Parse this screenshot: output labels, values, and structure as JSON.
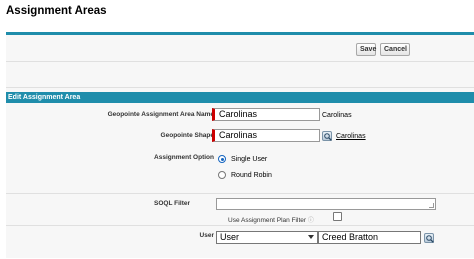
{
  "page": {
    "title": "Assignment Areas"
  },
  "toolbar": {
    "save_label": "Save",
    "cancel_label": "Cancel"
  },
  "section": {
    "title": "Edit Assignment Area"
  },
  "fields": {
    "area_name": {
      "label": "Geopointe Assignment Area Name",
      "value": "Carolinas",
      "preview": "Carolinas"
    },
    "shape": {
      "label": "Geopointe Shape",
      "value": "Carolinas",
      "link": "Carolinas"
    },
    "assignment_option": {
      "label": "Assignment Option",
      "options": [
        {
          "label": "Single User",
          "checked": true
        },
        {
          "label": "Round Robin",
          "checked": false
        }
      ]
    },
    "soql_filter": {
      "label": "SOQL Filter",
      "value": ""
    },
    "plan_filter": {
      "label": "Use Assignment Plan Filter",
      "hint": "ⓘ",
      "checked": false
    },
    "user": {
      "label": "User",
      "type_value": "User",
      "name_value": "Creed Bratton"
    }
  },
  "colors": {
    "accent": "#1f8dab",
    "required": "#cc0000"
  },
  "icons": {
    "lookup": "magnifier-lookup-icon",
    "select_arrow": "chevron-down-icon"
  }
}
